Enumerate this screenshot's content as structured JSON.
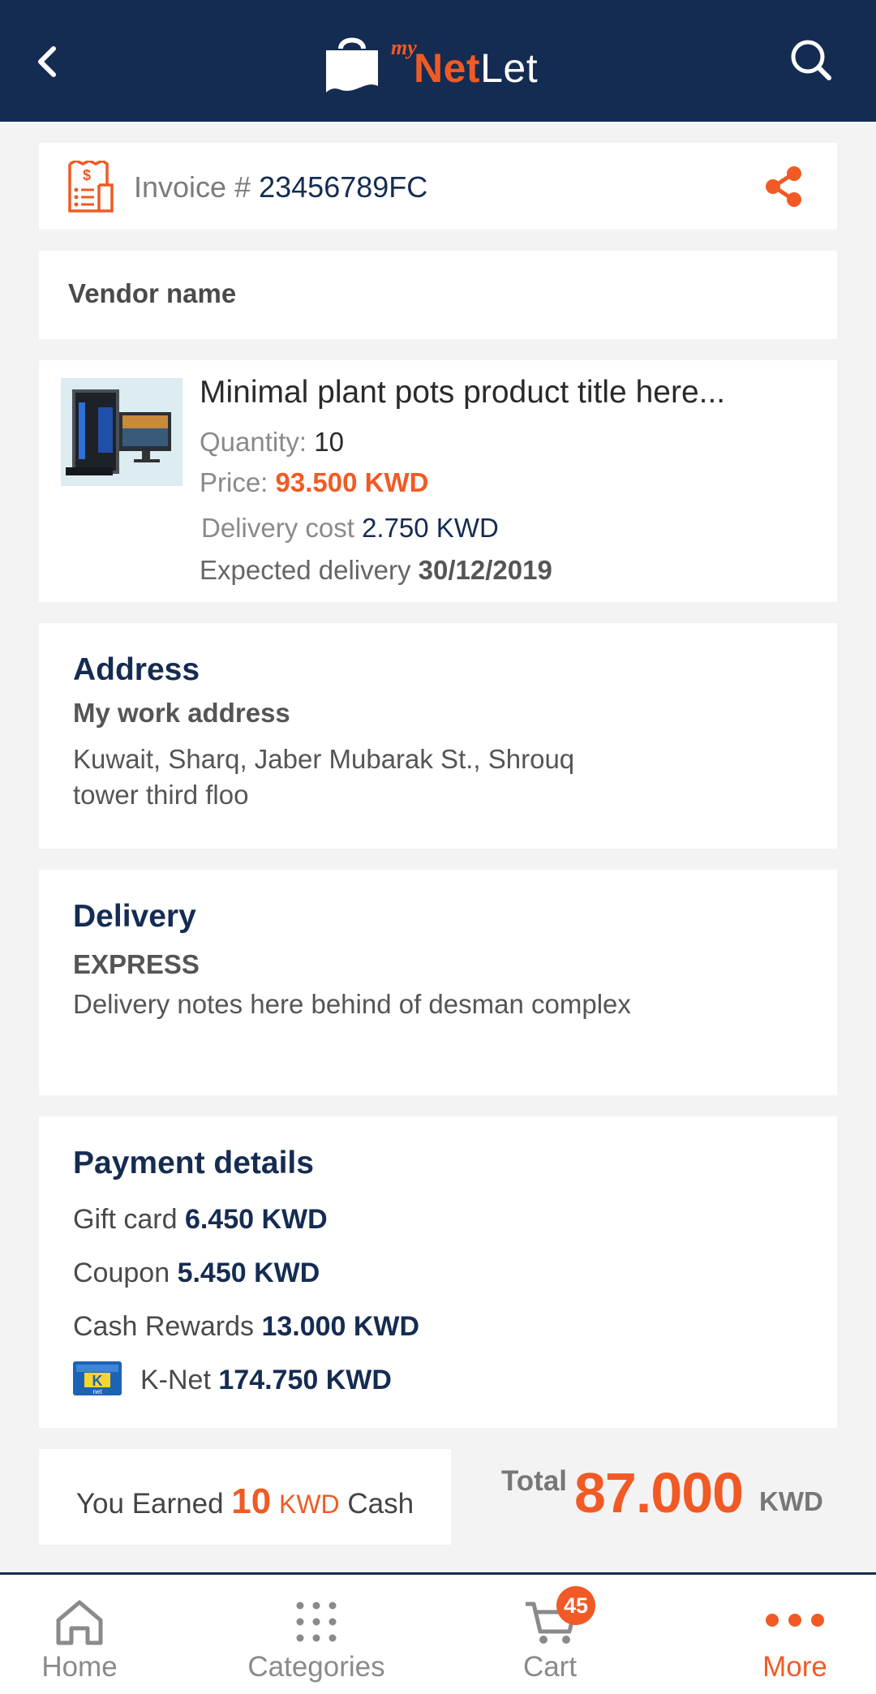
{
  "app": {
    "logo": {
      "my": "my",
      "net": "Net",
      "let": "Let"
    }
  },
  "invoice": {
    "label": "Invoice #",
    "number": "23456789FC"
  },
  "vendor": {
    "name": "Vendor name"
  },
  "product": {
    "title": "Minimal plant pots product title here...",
    "quantity_label": "Quantity:",
    "quantity": "10",
    "price_label": "Price:",
    "price": "93.500 KWD",
    "delivery_cost_label": "Delivery cost",
    "delivery_cost": "2.750 KWD",
    "expected_label": "Expected delivery",
    "expected_date": "30/12/2019"
  },
  "address": {
    "title": "Address",
    "name": "My work address",
    "line1": "Kuwait, Sharq, Jaber Mubarak St., Shrouq",
    "line2": "tower third floo"
  },
  "delivery": {
    "title": "Delivery",
    "type": "EXPRESS",
    "notes": "Delivery notes here behind of desman complex"
  },
  "payment": {
    "title": "Payment details",
    "rows": [
      {
        "label": "Gift card",
        "amount": "6.450 KWD"
      },
      {
        "label": "Coupon",
        "amount": "5.450 KWD"
      },
      {
        "label": "Cash Rewards",
        "amount": "13.000 KWD"
      },
      {
        "label": "K-Net",
        "amount": "174.750 KWD"
      }
    ]
  },
  "earned": {
    "prefix": "You Earned",
    "value": "10",
    "unit": "KWD",
    "suffix": "Cash"
  },
  "total": {
    "label": "Total",
    "value": "87.000",
    "unit": "KWD"
  },
  "nav": {
    "items": [
      {
        "label": "Home",
        "icon": "home-icon"
      },
      {
        "label": "Categories",
        "icon": "grid-icon"
      },
      {
        "label": "Cart",
        "icon": "cart-icon",
        "badge": "45"
      },
      {
        "label": "More",
        "icon": "more-icon",
        "active": true
      }
    ]
  },
  "colors": {
    "navy": "#152c52",
    "accent": "#f15a24"
  }
}
